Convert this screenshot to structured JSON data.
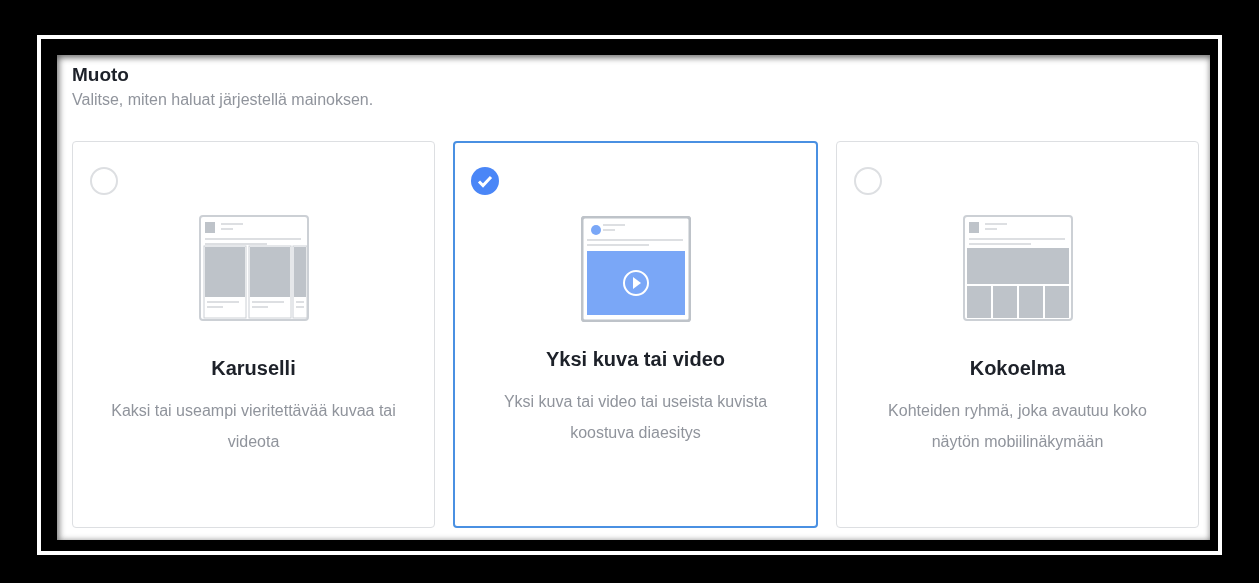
{
  "section": {
    "title": "Muoto",
    "subtitle": "Valitse, miten haluat järjestellä mainoksen."
  },
  "options": [
    {
      "kind": "carousel",
      "title": "Karuselli",
      "description": "Kaksi tai useampi vieritettävää kuvaa tai videota",
      "selected": false
    },
    {
      "kind": "video",
      "title": "Yksi kuva tai video",
      "description": "Yksi kuva tai video tai useista kuvista koostuva diaesitys",
      "selected": true
    },
    {
      "kind": "collection",
      "title": "Kokoelma",
      "description": "Kohteiden ryhmä, joka avautuu koko näytön mobiilinäkymään",
      "selected": false
    }
  ]
}
